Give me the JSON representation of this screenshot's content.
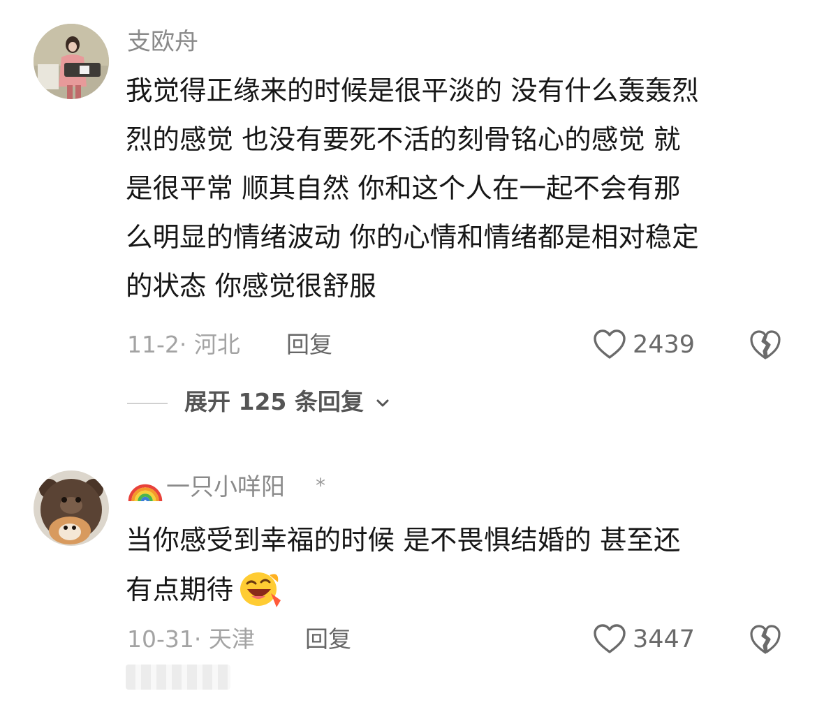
{
  "comments": [
    {
      "username": "支欧舟",
      "lines": [
        "我觉得正缘来的时候是很平淡的 没有什么轰轰烈",
        "烈的感觉 也没有要死不活的刻骨铭心的感觉 就",
        "是很平常 顺其自然 你和这个人在一起不会有那",
        "么明显的情绪波动 你的心情和情绪都是相对稳定",
        "的状态 你感觉很舒服"
      ],
      "meta": "11-2· 河北",
      "reply_label": "回复",
      "like_count": "2439",
      "expand_label": "展开 125 条回复"
    },
    {
      "username": "一只小咩阳",
      "user_flag": "*",
      "lines": [
        "当你感受到幸福的时候 是不畏惧结婚的 甚至还",
        "有点期待"
      ],
      "inline_emoji": "laughing-face-icon",
      "meta": "10-31· 天津",
      "reply_label": "回复",
      "like_count": "3447"
    }
  ],
  "icons": {
    "like": "heart-outline-icon",
    "dislike": "broken-heart-icon",
    "expand": "chevron-down-icon",
    "username_prefix": "rainbow-icon"
  },
  "colors": {
    "text_primary": "#161616",
    "text_secondary": "#8a8a8a",
    "text_meta": "#a3a3a3",
    "icon_gray": "#6a6a6a"
  }
}
